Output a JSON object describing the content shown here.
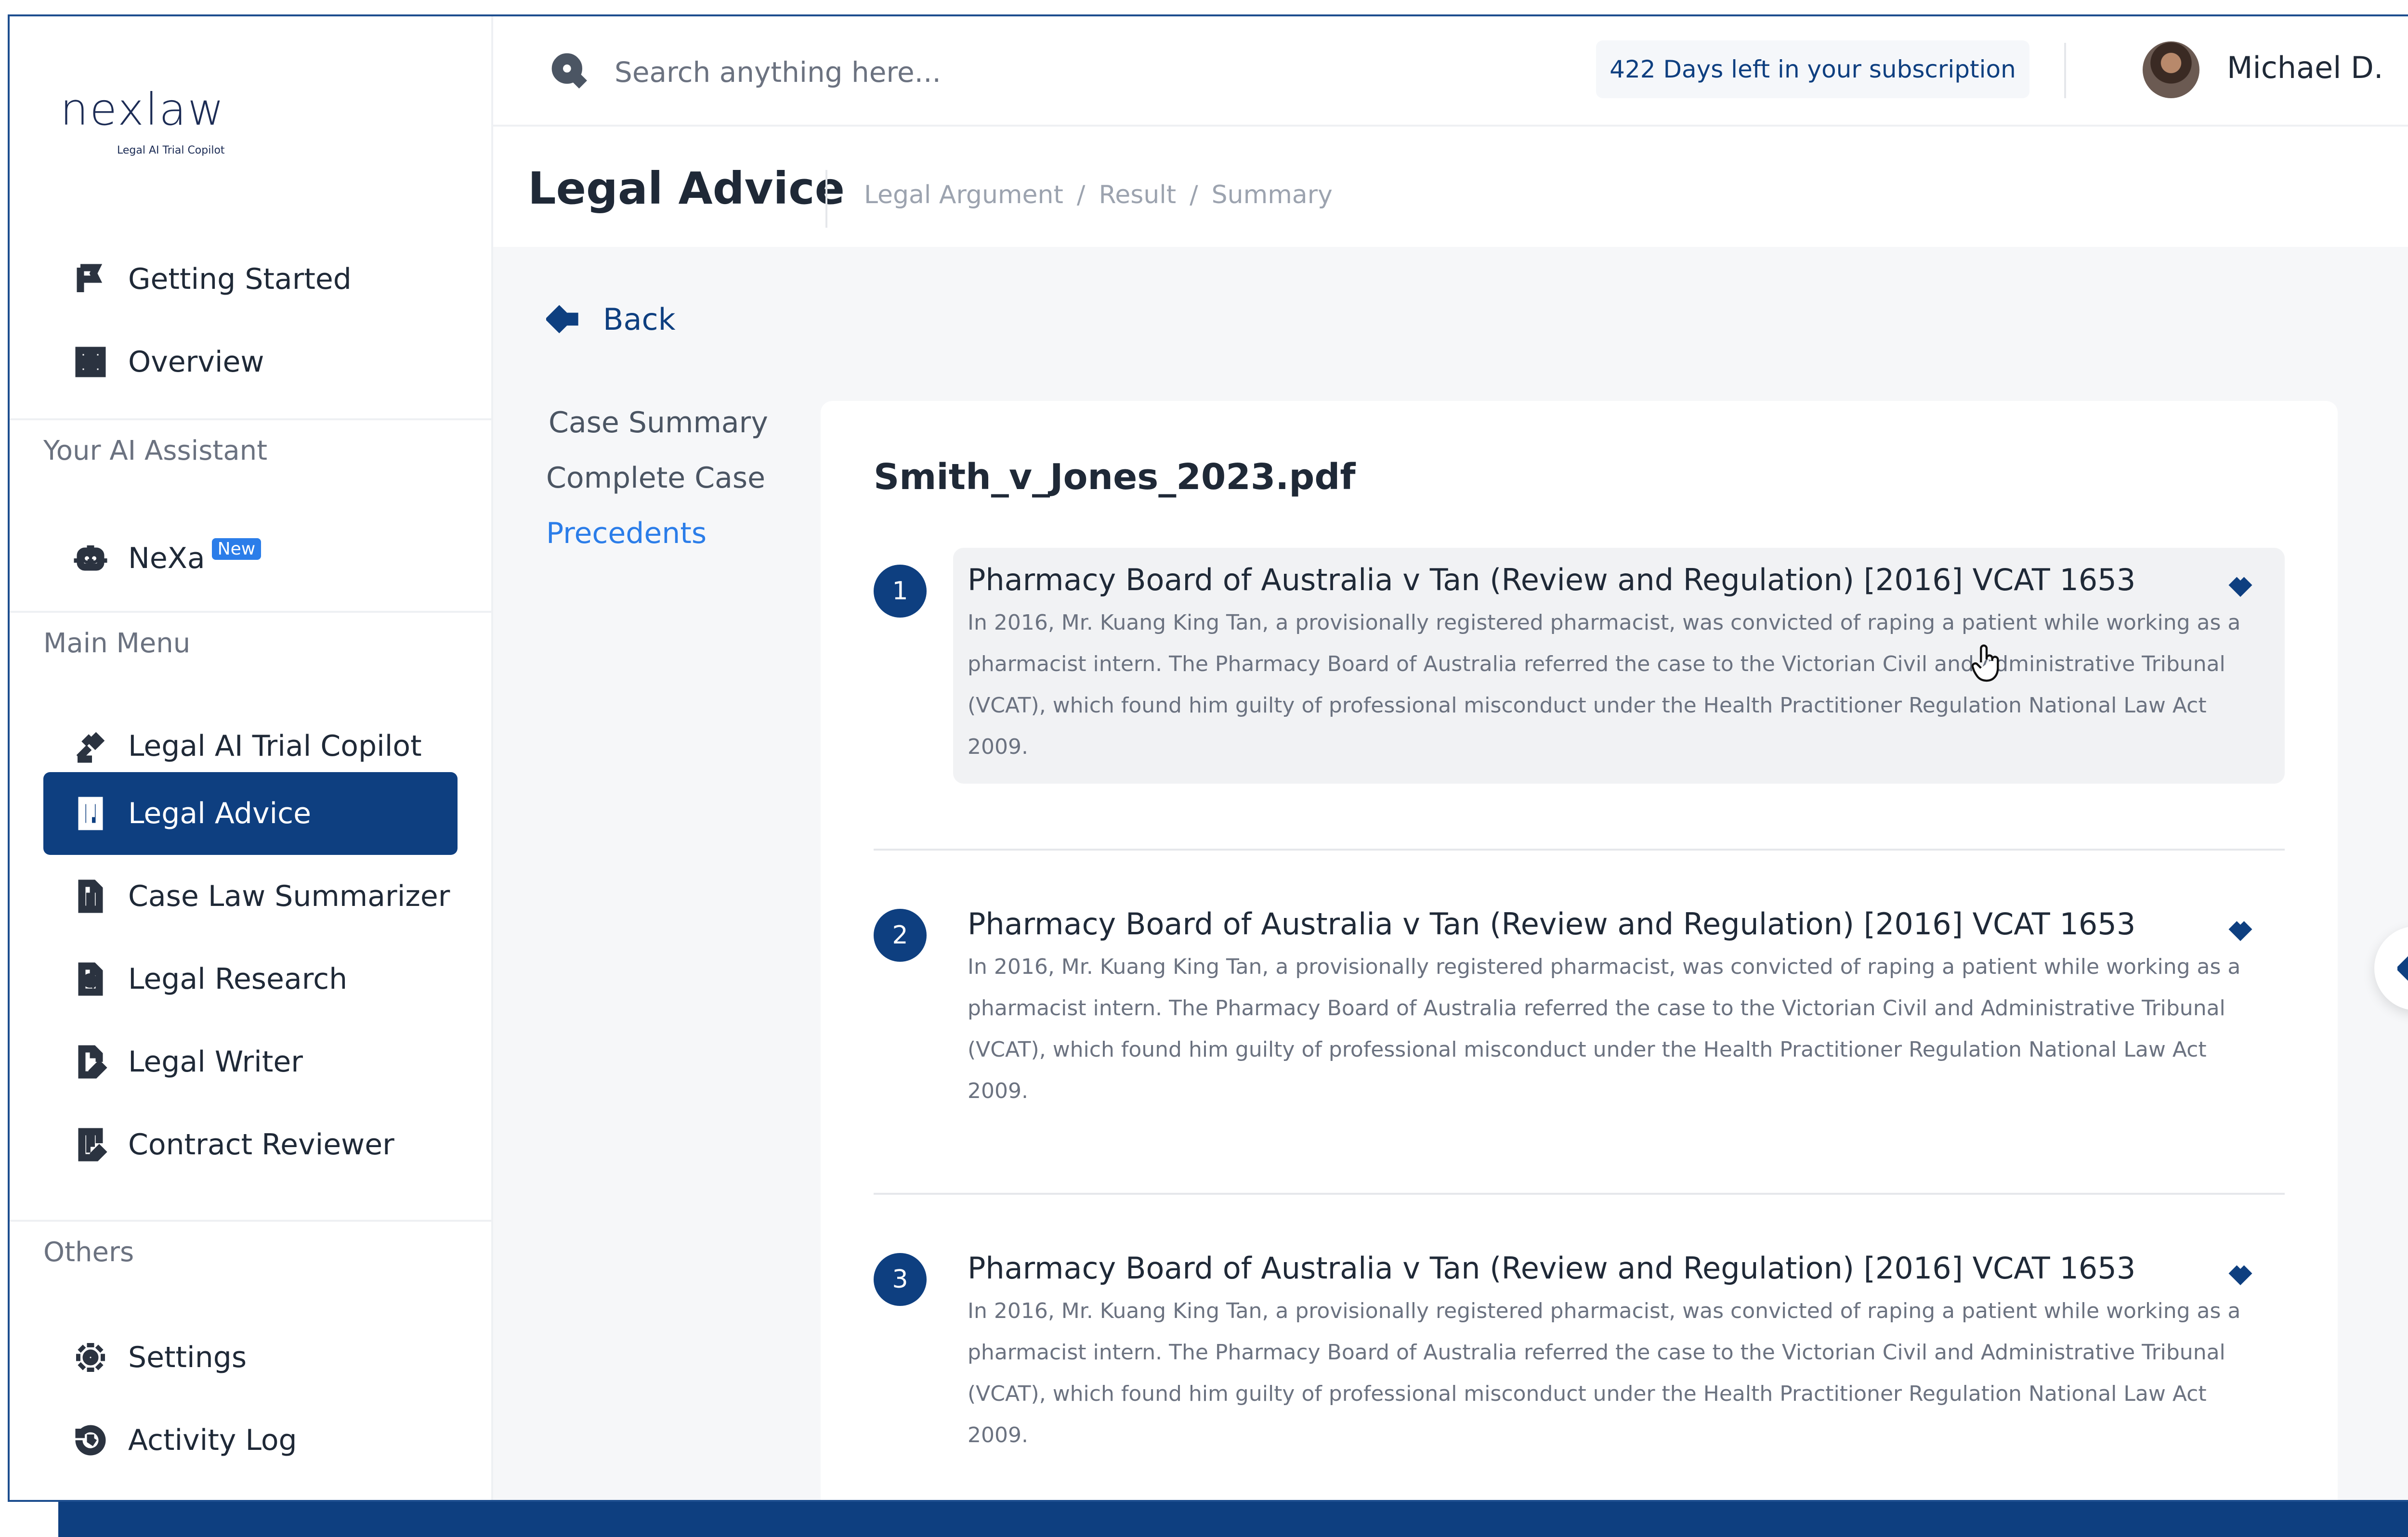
{
  "brand": {
    "name": "nexlaw",
    "tagline": "Legal AI Trial Copilot"
  },
  "sidebar": {
    "top_items": [
      {
        "label": "Getting Started",
        "icon": "flag-icon"
      },
      {
        "label": "Overview",
        "icon": "grid-icon"
      }
    ],
    "sections": {
      "assistant": "Your AI Assistant",
      "main_menu": "Main Menu",
      "others": "Others"
    },
    "assistant_item": {
      "label": "NeXa",
      "badge": "New",
      "icon": "robot-icon"
    },
    "main_items": [
      {
        "label": "Legal AI Trial Copilot",
        "icon": "gavel-icon"
      },
      {
        "label": "Legal Advice",
        "icon": "document-list-icon",
        "active": true
      },
      {
        "label": "Case Law Summarizer",
        "icon": "document-icon"
      },
      {
        "label": "Legal Research",
        "icon": "document-search-icon"
      },
      {
        "label": "Legal Writer",
        "icon": "document-pen-icon"
      },
      {
        "label": "Contract Reviewer",
        "icon": "contract-edit-icon"
      }
    ],
    "other_items": [
      {
        "label": "Settings",
        "icon": "gear-icon"
      },
      {
        "label": "Activity Log",
        "icon": "history-icon"
      }
    ]
  },
  "topbar": {
    "search_placeholder": "Search anything here...",
    "subscription": "422 Days left in your subscription",
    "user_name": "Michael D."
  },
  "header": {
    "title": "Legal Advice",
    "breadcrumbs": [
      "Legal Argument",
      "Result",
      "Summary"
    ]
  },
  "main": {
    "back_label": "Back",
    "subnav": [
      "Case Summary",
      "Complete Case",
      "Precedents"
    ],
    "active_subnav": "Precedents",
    "file_name": "Smith_v_Jones_2023.pdf",
    "precedents": [
      {
        "number": "1",
        "title": "Pharmacy Board of Australia v Tan (Review and Regulation) [2016] VCAT 1653",
        "description": "In 2016, Mr. Kuang King Tan, a provisionally registered pharmacist, was convicted of raping a patient while working as a pharmacist intern. The Pharmacy Board of Australia referred the case to the Victorian Civil and Administrative Tribunal (VCAT), which found him guilty of professional misconduct under the Health Practitioner Regulation National Law Act 2009."
      },
      {
        "number": "2",
        "title": "Pharmacy Board of Australia v Tan (Review and Regulation) [2016] VCAT 1653",
        "description": "In 2016, Mr. Kuang King Tan, a provisionally registered pharmacist, was convicted of raping a patient while working as a pharmacist intern. The Pharmacy Board of Australia referred the case to the Victorian Civil and Administrative Tribunal (VCAT), which found him guilty of professional misconduct under the Health Practitioner Regulation National Law Act 2009."
      },
      {
        "number": "3",
        "title": "Pharmacy Board of Australia v Tan (Review and Regulation) [2016] VCAT 1653",
        "description": "In 2016, Mr. Kuang King Tan, a provisionally registered pharmacist, was convicted of raping a patient while working as a pharmacist intern. The Pharmacy Board of Australia referred the case to the Victorian Civil and Administrative Tribunal (VCAT), which found him guilty of professional misconduct under the Health Practitioner Regulation National Law Act 2009."
      }
    ]
  },
  "colors": {
    "primary": "#0e3f80",
    "accent": "#2b7de9",
    "muted": "#6b7280"
  }
}
